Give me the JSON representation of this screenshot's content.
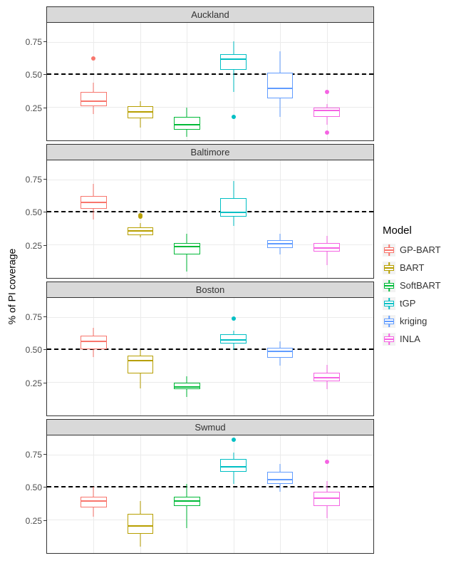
{
  "chart_data": {
    "type": "boxplot",
    "ylabel": "% of PI coverage",
    "ylim": [
      0,
      0.9
    ],
    "yticks": [
      0.25,
      0.5,
      0.75
    ],
    "refline": 0.5,
    "legend_title": "Model",
    "models": [
      {
        "name": "GP-BART",
        "color": "#F8766D"
      },
      {
        "name": "BART",
        "color": "#B79F00"
      },
      {
        "name": "SoftBART",
        "color": "#00BA38"
      },
      {
        "name": "tGP",
        "color": "#00BFC4"
      },
      {
        "name": "kriging",
        "color": "#619CFF"
      },
      {
        "name": "INLA",
        "color": "#F564E3"
      }
    ],
    "facets": [
      {
        "title": "Auckland",
        "series": [
          {
            "model": "GP-BART",
            "min": 0.2,
            "q1": 0.26,
            "median": 0.3,
            "q3": 0.37,
            "max": 0.44,
            "outliers": [
              0.63
            ]
          },
          {
            "model": "BART",
            "min": 0.1,
            "q1": 0.17,
            "median": 0.22,
            "q3": 0.26,
            "max": 0.3,
            "outliers": []
          },
          {
            "model": "SoftBART",
            "min": 0.03,
            "q1": 0.08,
            "median": 0.12,
            "q3": 0.18,
            "max": 0.25,
            "outliers": []
          },
          {
            "model": "tGP",
            "min": 0.37,
            "q1": 0.54,
            "median": 0.62,
            "q3": 0.66,
            "max": 0.76,
            "outliers": [
              0.18
            ]
          },
          {
            "model": "kriging",
            "min": 0.18,
            "q1": 0.32,
            "median": 0.4,
            "q3": 0.52,
            "max": 0.68,
            "outliers": []
          },
          {
            "model": "INLA",
            "min": 0.12,
            "q1": 0.18,
            "median": 0.23,
            "q3": 0.25,
            "max": 0.28,
            "outliers": [
              0.37,
              0.06
            ]
          }
        ]
      },
      {
        "title": "Baltimore",
        "series": [
          {
            "model": "GP-BART",
            "min": 0.45,
            "q1": 0.53,
            "median": 0.58,
            "q3": 0.63,
            "max": 0.72,
            "outliers": []
          },
          {
            "model": "BART",
            "min": 0.31,
            "q1": 0.33,
            "median": 0.36,
            "q3": 0.39,
            "max": 0.42,
            "outliers": [
              0.48,
              0.47
            ]
          },
          {
            "model": "SoftBART",
            "min": 0.05,
            "q1": 0.18,
            "median": 0.24,
            "q3": 0.27,
            "max": 0.34,
            "outliers": []
          },
          {
            "model": "tGP",
            "min": 0.4,
            "q1": 0.47,
            "median": 0.5,
            "q3": 0.61,
            "max": 0.74,
            "outliers": []
          },
          {
            "model": "kriging",
            "min": 0.18,
            "q1": 0.23,
            "median": 0.26,
            "q3": 0.29,
            "max": 0.34,
            "outliers": []
          },
          {
            "model": "INLA",
            "min": 0.1,
            "q1": 0.2,
            "median": 0.23,
            "q3": 0.27,
            "max": 0.32,
            "outliers": []
          }
        ]
      },
      {
        "title": "Boston",
        "series": [
          {
            "model": "GP-BART",
            "min": 0.45,
            "q1": 0.51,
            "median": 0.57,
            "q3": 0.61,
            "max": 0.67,
            "outliers": []
          },
          {
            "model": "BART",
            "min": 0.21,
            "q1": 0.32,
            "median": 0.42,
            "q3": 0.46,
            "max": 0.5,
            "outliers": []
          },
          {
            "model": "SoftBART",
            "min": 0.14,
            "q1": 0.2,
            "median": 0.22,
            "q3": 0.25,
            "max": 0.3,
            "outliers": []
          },
          {
            "model": "tGP",
            "min": 0.5,
            "q1": 0.55,
            "median": 0.58,
            "q3": 0.62,
            "max": 0.65,
            "outliers": [
              0.74
            ]
          },
          {
            "model": "kriging",
            "min": 0.38,
            "q1": 0.44,
            "median": 0.49,
            "q3": 0.52,
            "max": 0.57,
            "outliers": []
          },
          {
            "model": "INLA",
            "min": 0.2,
            "q1": 0.26,
            "median": 0.29,
            "q3": 0.33,
            "max": 0.39,
            "outliers": []
          }
        ]
      },
      {
        "title": "Swmud",
        "series": [
          {
            "model": "GP-BART",
            "min": 0.28,
            "q1": 0.35,
            "median": 0.4,
            "q3": 0.43,
            "max": 0.51,
            "outliers": []
          },
          {
            "model": "BART",
            "min": 0.05,
            "q1": 0.15,
            "median": 0.21,
            "q3": 0.3,
            "max": 0.4,
            "outliers": []
          },
          {
            "model": "SoftBART",
            "min": 0.19,
            "q1": 0.36,
            "median": 0.4,
            "q3": 0.43,
            "max": 0.53,
            "outliers": []
          },
          {
            "model": "tGP",
            "min": 0.53,
            "q1": 0.62,
            "median": 0.66,
            "q3": 0.72,
            "max": 0.77,
            "outliers": [
              0.87
            ]
          },
          {
            "model": "kriging",
            "min": 0.47,
            "q1": 0.53,
            "median": 0.56,
            "q3": 0.62,
            "max": 0.68,
            "outliers": []
          },
          {
            "model": "INLA",
            "min": 0.27,
            "q1": 0.36,
            "median": 0.42,
            "q3": 0.47,
            "max": 0.55,
            "outliers": [
              0.7
            ]
          }
        ]
      }
    ]
  }
}
